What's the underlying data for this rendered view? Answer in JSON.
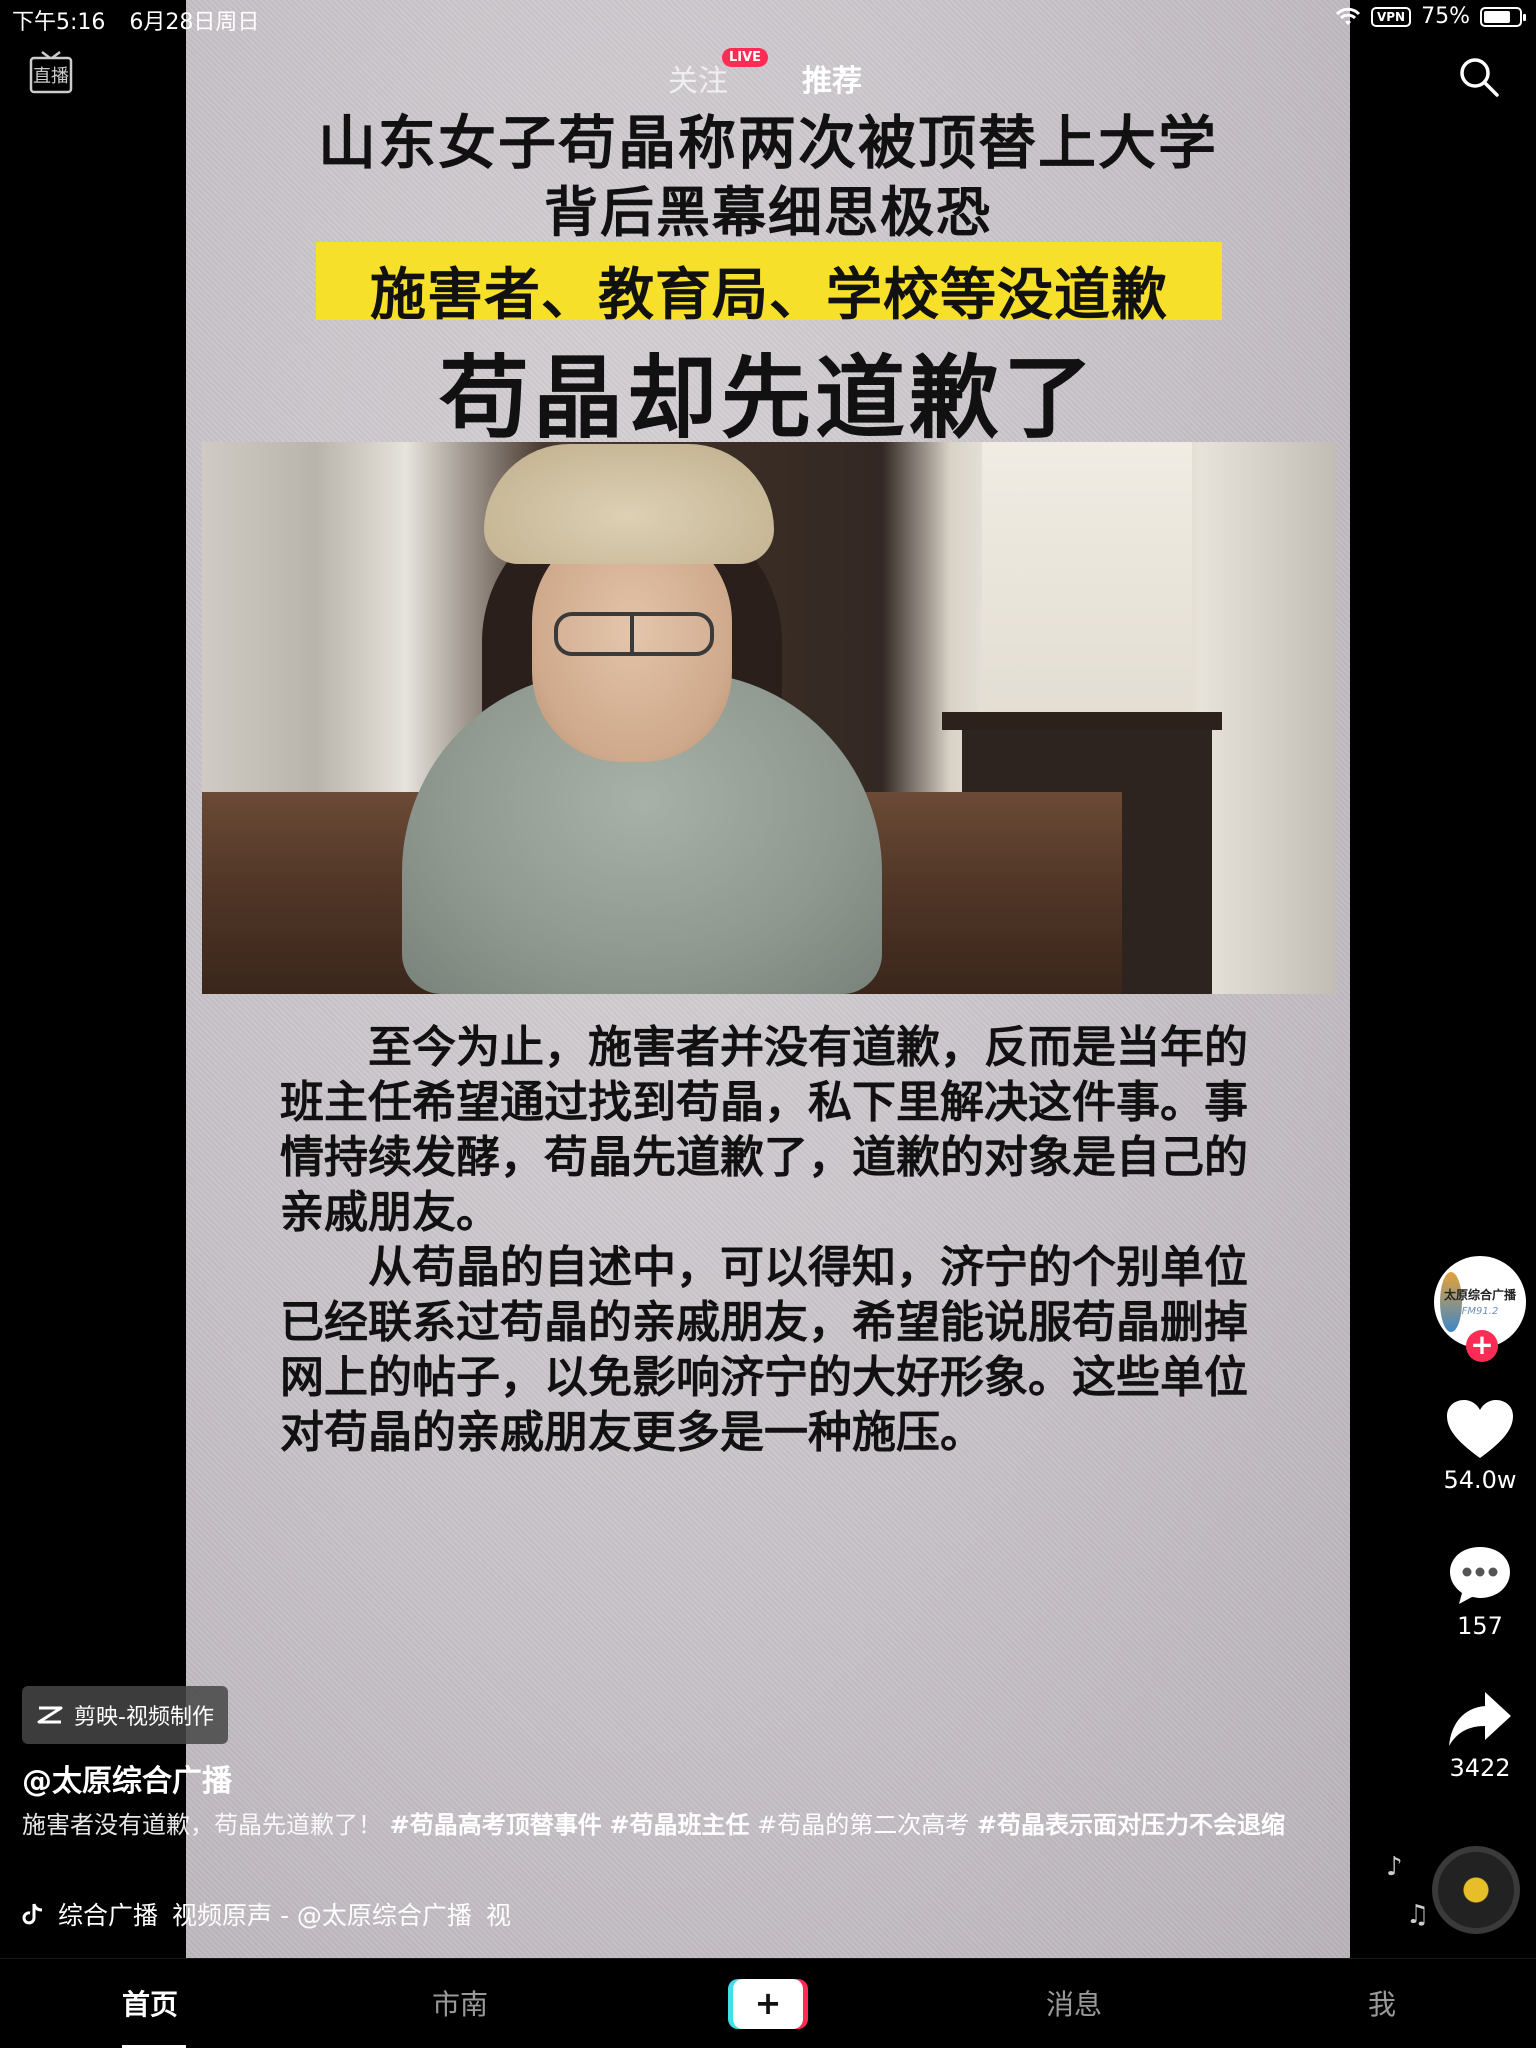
{
  "status_bar": {
    "time": "下午5:16",
    "date": "6月28日周日",
    "vpn": "VPN",
    "battery": "75%",
    "battery_level": 0.75
  },
  "top_nav": {
    "live_button_label": "直播",
    "tab_follow": "关注",
    "live_badge": "LIVE",
    "tab_recommend": "推荐"
  },
  "video": {
    "headline_1": "山东女子苟晶称两次被顶替上大学",
    "headline_2": "背后黑幕细思极恐",
    "headline_3": "施害者、教育局、学校等没道歉",
    "headline_4": "苟晶却先道歉了",
    "paragraph_1": "至今为止，施害者并没有道歉，反而是当年的班主任希望通过找到苟晶，私下里解决这件事。事情持续发酵，苟晶先道歉了，道歉的对象是自己的亲戚朋友。",
    "paragraph_2": "从苟晶的自述中，可以得知，济宁的个别单位已经联系过苟晶的亲戚朋友，希望能说服苟晶删掉网上的帖子，以免影响济宁的大好形象。这些单位对苟晶的亲戚朋友更多是一种施压。"
  },
  "actions": {
    "avatar_name": "太原综合广播",
    "avatar_sub": "FM91.2",
    "follow_symbol": "+",
    "likes": "54.0w",
    "comments": "157",
    "shares": "3422"
  },
  "info": {
    "capcut_label": "剪映-视频制作",
    "author": "@太原综合广播",
    "caption_plain": "施害者没有道歉，苟晶先道歉了！",
    "tag_1": "#苟晶高考顶替事件",
    "tag_2": "#苟晶班主任",
    "tag_3": "#苟晶的第二次高考",
    "tag_4": "#苟晶表示面对压力不会退缩",
    "sound_part_1": "综合广播",
    "sound_part_2": "视频原声 - @太原综合广播",
    "sound_part_3": "视"
  },
  "tab_bar": {
    "home": "首页",
    "city": "市南",
    "create_symbol": "+",
    "messages": "消息",
    "me": "我"
  }
}
